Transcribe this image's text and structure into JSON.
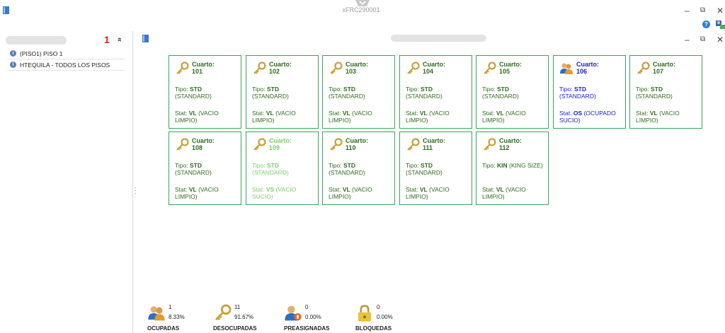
{
  "window": {
    "title": "xFRC290001",
    "minimize": "–",
    "restore": "⧉",
    "close": "✕",
    "help": "?"
  },
  "left_panel": {
    "badge": "1",
    "collapse": "»",
    "items": [
      {
        "label": "(PISO1) PISO 1",
        "icon": "info-icon"
      },
      {
        "label": "HTEQUILA - TODOS LOS PISOS",
        "icon": "info-icon"
      }
    ]
  },
  "main": {
    "minimize": "–",
    "restore": "⧉",
    "close": "✕"
  },
  "rooms": [
    {
      "label": "Cuarto:",
      "number": "101",
      "tipo_prefix": "Tipo:",
      "tipo_code": "STD",
      "tipo_desc": "(STANDARD)",
      "stat_prefix": "Stat:",
      "stat_code": "VL",
      "stat_desc": "(VACIO LIMPIO)",
      "status": "normal",
      "icon": "key-icon"
    },
    {
      "label": "Cuarto:",
      "number": "102",
      "tipo_prefix": "Tipo:",
      "tipo_code": "STD",
      "tipo_desc": "(STANDARD)",
      "stat_prefix": "Stat:",
      "stat_code": "VL",
      "stat_desc": "(VACIO LIMPIO)",
      "status": "normal",
      "icon": "key-icon"
    },
    {
      "label": "Cuarto:",
      "number": "103",
      "tipo_prefix": "Tipo:",
      "tipo_code": "STD",
      "tipo_desc": "(STANDARD)",
      "stat_prefix": "Stat:",
      "stat_code": "VL",
      "stat_desc": "(VACIO LIMPIO)",
      "status": "normal",
      "icon": "key-icon"
    },
    {
      "label": "Cuarto:",
      "number": "104",
      "tipo_prefix": "Tipo:",
      "tipo_code": "STD",
      "tipo_desc": "(STANDARD)",
      "stat_prefix": "Stat:",
      "stat_code": "VL",
      "stat_desc": "(VACIO LIMPIO)",
      "status": "normal",
      "icon": "key-icon"
    },
    {
      "label": "Cuarto:",
      "number": "105",
      "tipo_prefix": "Tipo:",
      "tipo_code": "STD",
      "tipo_desc": "(STANDARD)",
      "stat_prefix": "Stat:",
      "stat_code": "VL",
      "stat_desc": "(VACIO LIMPIO)",
      "status": "normal",
      "icon": "key-icon"
    },
    {
      "label": "Cuarto:",
      "number": "106",
      "tipo_prefix": "Tipo:",
      "tipo_code": "STD",
      "tipo_desc": "(STANDARD)",
      "stat_prefix": "Stat:",
      "stat_code": "OS",
      "stat_desc": "(OCUPADO SUCIO)",
      "status": "occ",
      "icon": "guests-icon"
    },
    {
      "label": "Cuarto:",
      "number": "107",
      "tipo_prefix": "Tipo:",
      "tipo_code": "STD",
      "tipo_desc": "(STANDARD)",
      "stat_prefix": "Stat:",
      "stat_code": "VL",
      "stat_desc": "(VACIO LIMPIO)",
      "status": "normal",
      "icon": "key-icon"
    },
    {
      "label": "Cuarto:",
      "number": "108",
      "tipo_prefix": "Tipo:",
      "tipo_code": "STD",
      "tipo_desc": "(STANDARD)",
      "stat_prefix": "Stat:",
      "stat_code": "VL",
      "stat_desc": "(VACIO LIMPIO)",
      "status": "normal",
      "icon": "key-icon"
    },
    {
      "label": "Cuarto:",
      "number": "109",
      "tipo_prefix": "Tipo:",
      "tipo_code": "STD",
      "tipo_desc": "(STANDARD)",
      "stat_prefix": "Stat:",
      "stat_code": "VS",
      "stat_desc": "(VACIO SUCIO)",
      "status": "dirty",
      "icon": "key-icon"
    },
    {
      "label": "Cuarto:",
      "number": "110",
      "tipo_prefix": "Tipo:",
      "tipo_code": "STD",
      "tipo_desc": "(STANDARD)",
      "stat_prefix": "Stat:",
      "stat_code": "VL",
      "stat_desc": "(VACIO LIMPIO)",
      "status": "normal",
      "icon": "key-icon"
    },
    {
      "label": "Cuarto:",
      "number": "111",
      "tipo_prefix": "Tipo:",
      "tipo_code": "STD",
      "tipo_desc": "(STANDARD)",
      "stat_prefix": "Stat:",
      "stat_code": "VL",
      "stat_desc": "(VACIO LIMPIO)",
      "status": "normal",
      "icon": "key-icon"
    },
    {
      "label": "Cuarto:",
      "number": "112",
      "tipo_prefix": "Tipo:",
      "tipo_code": "KIN",
      "tipo_desc": "(KING SIZE)",
      "stat_prefix": "Stat:",
      "stat_code": "VL",
      "stat_desc": "(VACIO LIMPIO)",
      "status": "normal",
      "icon": "key-icon"
    }
  ],
  "summary": [
    {
      "count": "1",
      "percent": "8.33%",
      "label": "OCUPADAS",
      "icon": "guests-icon"
    },
    {
      "count": "11",
      "percent": "91.67%",
      "label": "DESOCUPADAS",
      "icon": "key-icon"
    },
    {
      "count": "0",
      "percent": "0.00%",
      "label": "PREASIGNADAS",
      "icon": "reserved-guest-icon"
    },
    {
      "count": "0",
      "percent": "0.00%",
      "label": "BLOQUEDAS",
      "icon": "lock-icon"
    }
  ],
  "colors": {
    "card_border": "#3aa35a",
    "status_normal": "#2e6b1e",
    "status_occupied": "#1b22d0",
    "status_dirty": "#7ccf6a"
  }
}
